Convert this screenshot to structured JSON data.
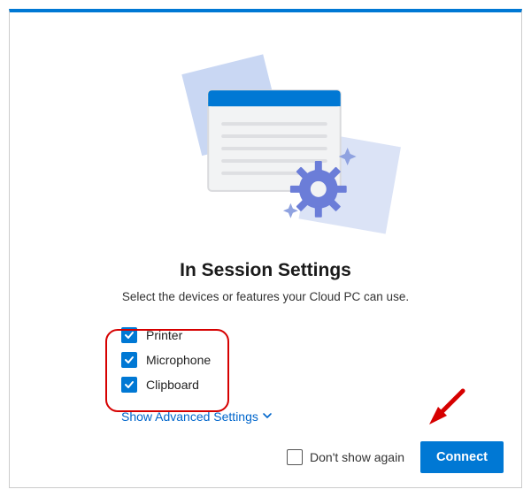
{
  "title": "In Session Settings",
  "subtitle": "Select the devices or features your Cloud PC can use.",
  "options": [
    {
      "label": "Printer",
      "checked": true
    },
    {
      "label": "Microphone",
      "checked": true
    },
    {
      "label": "Clipboard",
      "checked": true
    }
  ],
  "advanced_label": "Show Advanced Settings",
  "footer": {
    "dont_show_label": "Don't show again",
    "dont_show_checked": false,
    "connect_label": "Connect"
  },
  "colors": {
    "accent": "#0078d4",
    "link": "#0066cc",
    "highlight": "#d60000"
  }
}
